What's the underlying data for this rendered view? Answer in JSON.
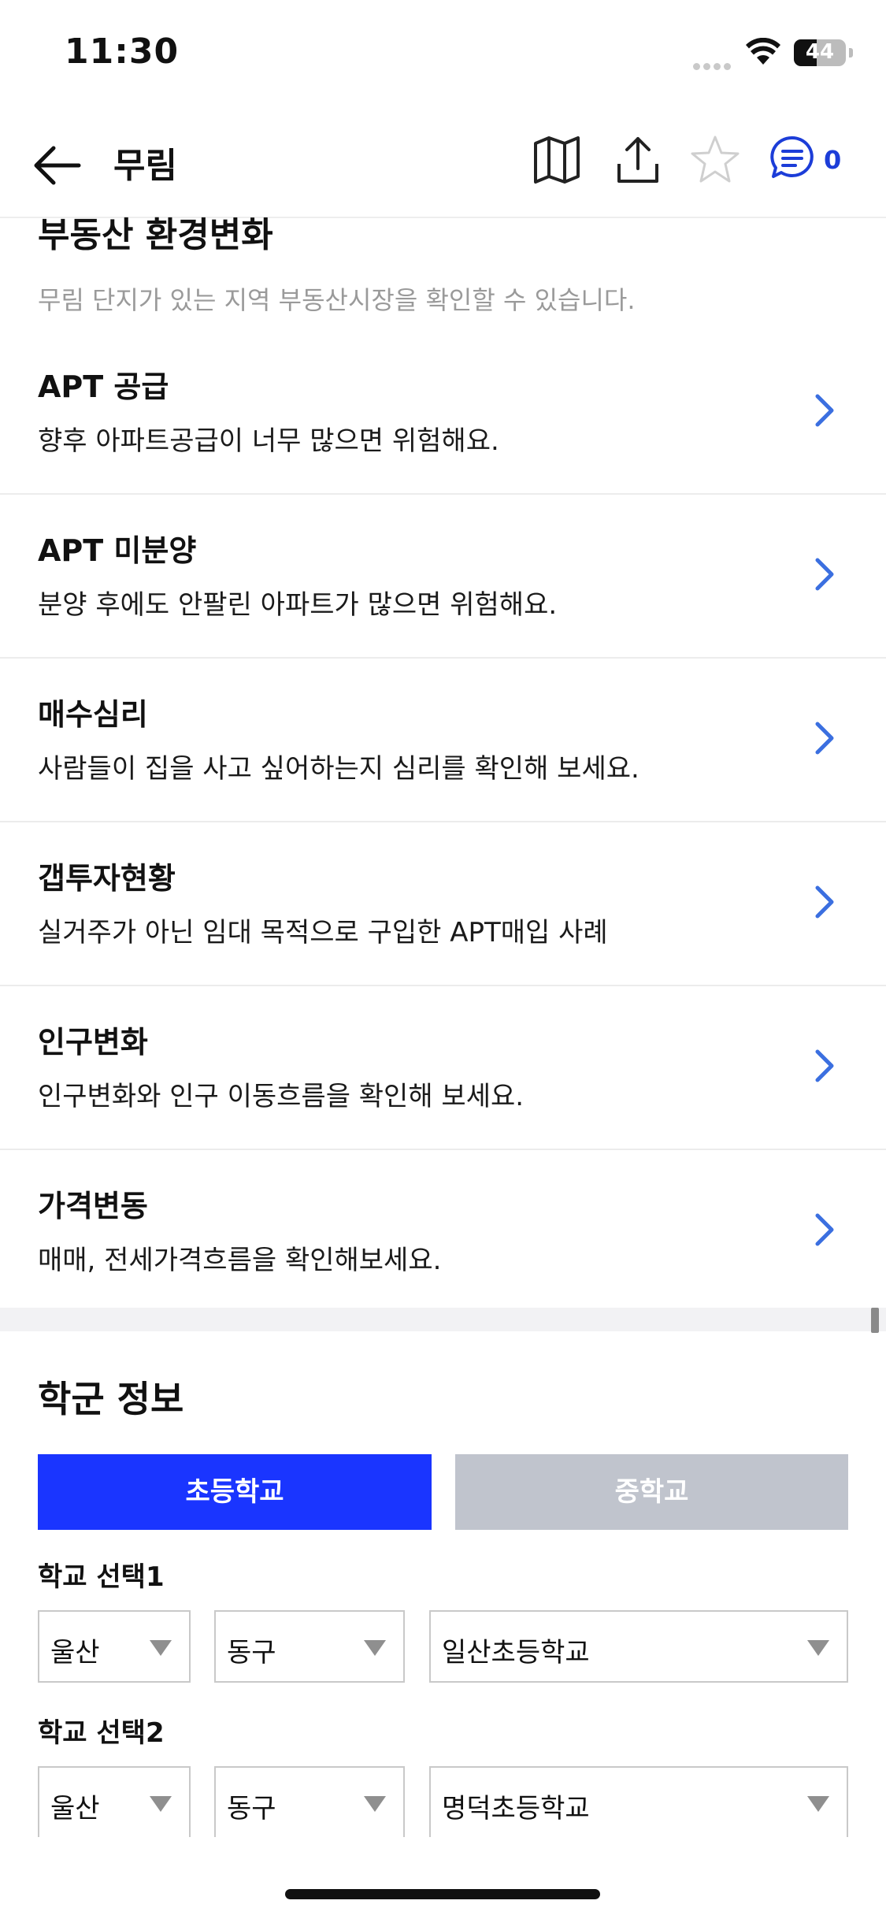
{
  "status": {
    "time": "11:30",
    "battery": "44"
  },
  "header": {
    "title": "무림",
    "chat_count": "0"
  },
  "section": {
    "title": "부동산 환경변화",
    "desc": "무림 단지가 있는 지역 부동산시장을 확인할 수 있습니다."
  },
  "items": [
    {
      "title": "APT 공급",
      "desc": "향후 아파트공급이 너무 많으면 위험해요."
    },
    {
      "title": "APT 미분양",
      "desc": "분양 후에도 안팔린 아파트가 많으면 위험해요."
    },
    {
      "title": "매수심리",
      "desc": "사람들이 집을 사고 싶어하는지 심리를 확인해 보세요."
    },
    {
      "title": "갭투자현황",
      "desc": "실거주가 아닌 임대 목적으로 구입한 APT매입 사례"
    },
    {
      "title": "인구변화",
      "desc": "인구변화와 인구 이동흐름을 확인해 보세요."
    },
    {
      "title": "가격변동",
      "desc": "매매, 전세가격흐름을 확인해보세요."
    }
  ],
  "school": {
    "title": "학군 정보",
    "tab_elementary": "초등학교",
    "tab_middle": "중학교",
    "select1": {
      "label": "학교 선택1",
      "city": "울산",
      "district": "동구",
      "school": "일산초등학교"
    },
    "select2": {
      "label": "학교 선택2",
      "city": "울산",
      "district": "동구",
      "school": "명덕초등학교"
    }
  },
  "colors": {
    "accent": "#1a35ff",
    "chevron": "#3b6fe0",
    "inactive_tab": "#c0c4cd"
  }
}
